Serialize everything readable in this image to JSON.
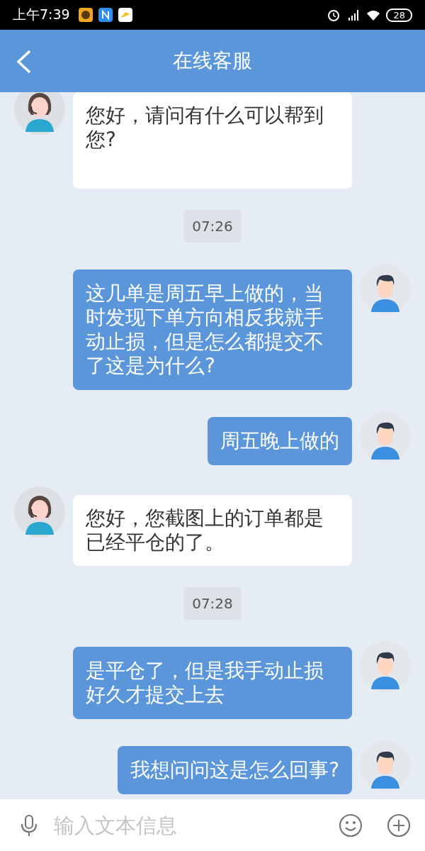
{
  "status_bar": {
    "time": "上午7:39",
    "battery": "28"
  },
  "header": {
    "title": "在线客服"
  },
  "messages": [
    {
      "kind": "agent",
      "text": "您好，请问有什么可以帮到您?"
    },
    {
      "kind": "time",
      "text": "07:26"
    },
    {
      "kind": "user",
      "text": "这几单是周五早上做的，当时发现下单方向相反我就手动止损，但是怎么都提交不了这是为什么?"
    },
    {
      "kind": "user",
      "text": "周五晚上做的"
    },
    {
      "kind": "agent",
      "text": "您好，您截图上的订单都是已经平仓的了。"
    },
    {
      "kind": "time",
      "text": "07:28"
    },
    {
      "kind": "user",
      "text": "是平仓了，但是我手动止损好久才提交上去"
    },
    {
      "kind": "user",
      "text": "我想问问这是怎么回事?"
    }
  ],
  "input": {
    "placeholder": "输入文本信息"
  }
}
